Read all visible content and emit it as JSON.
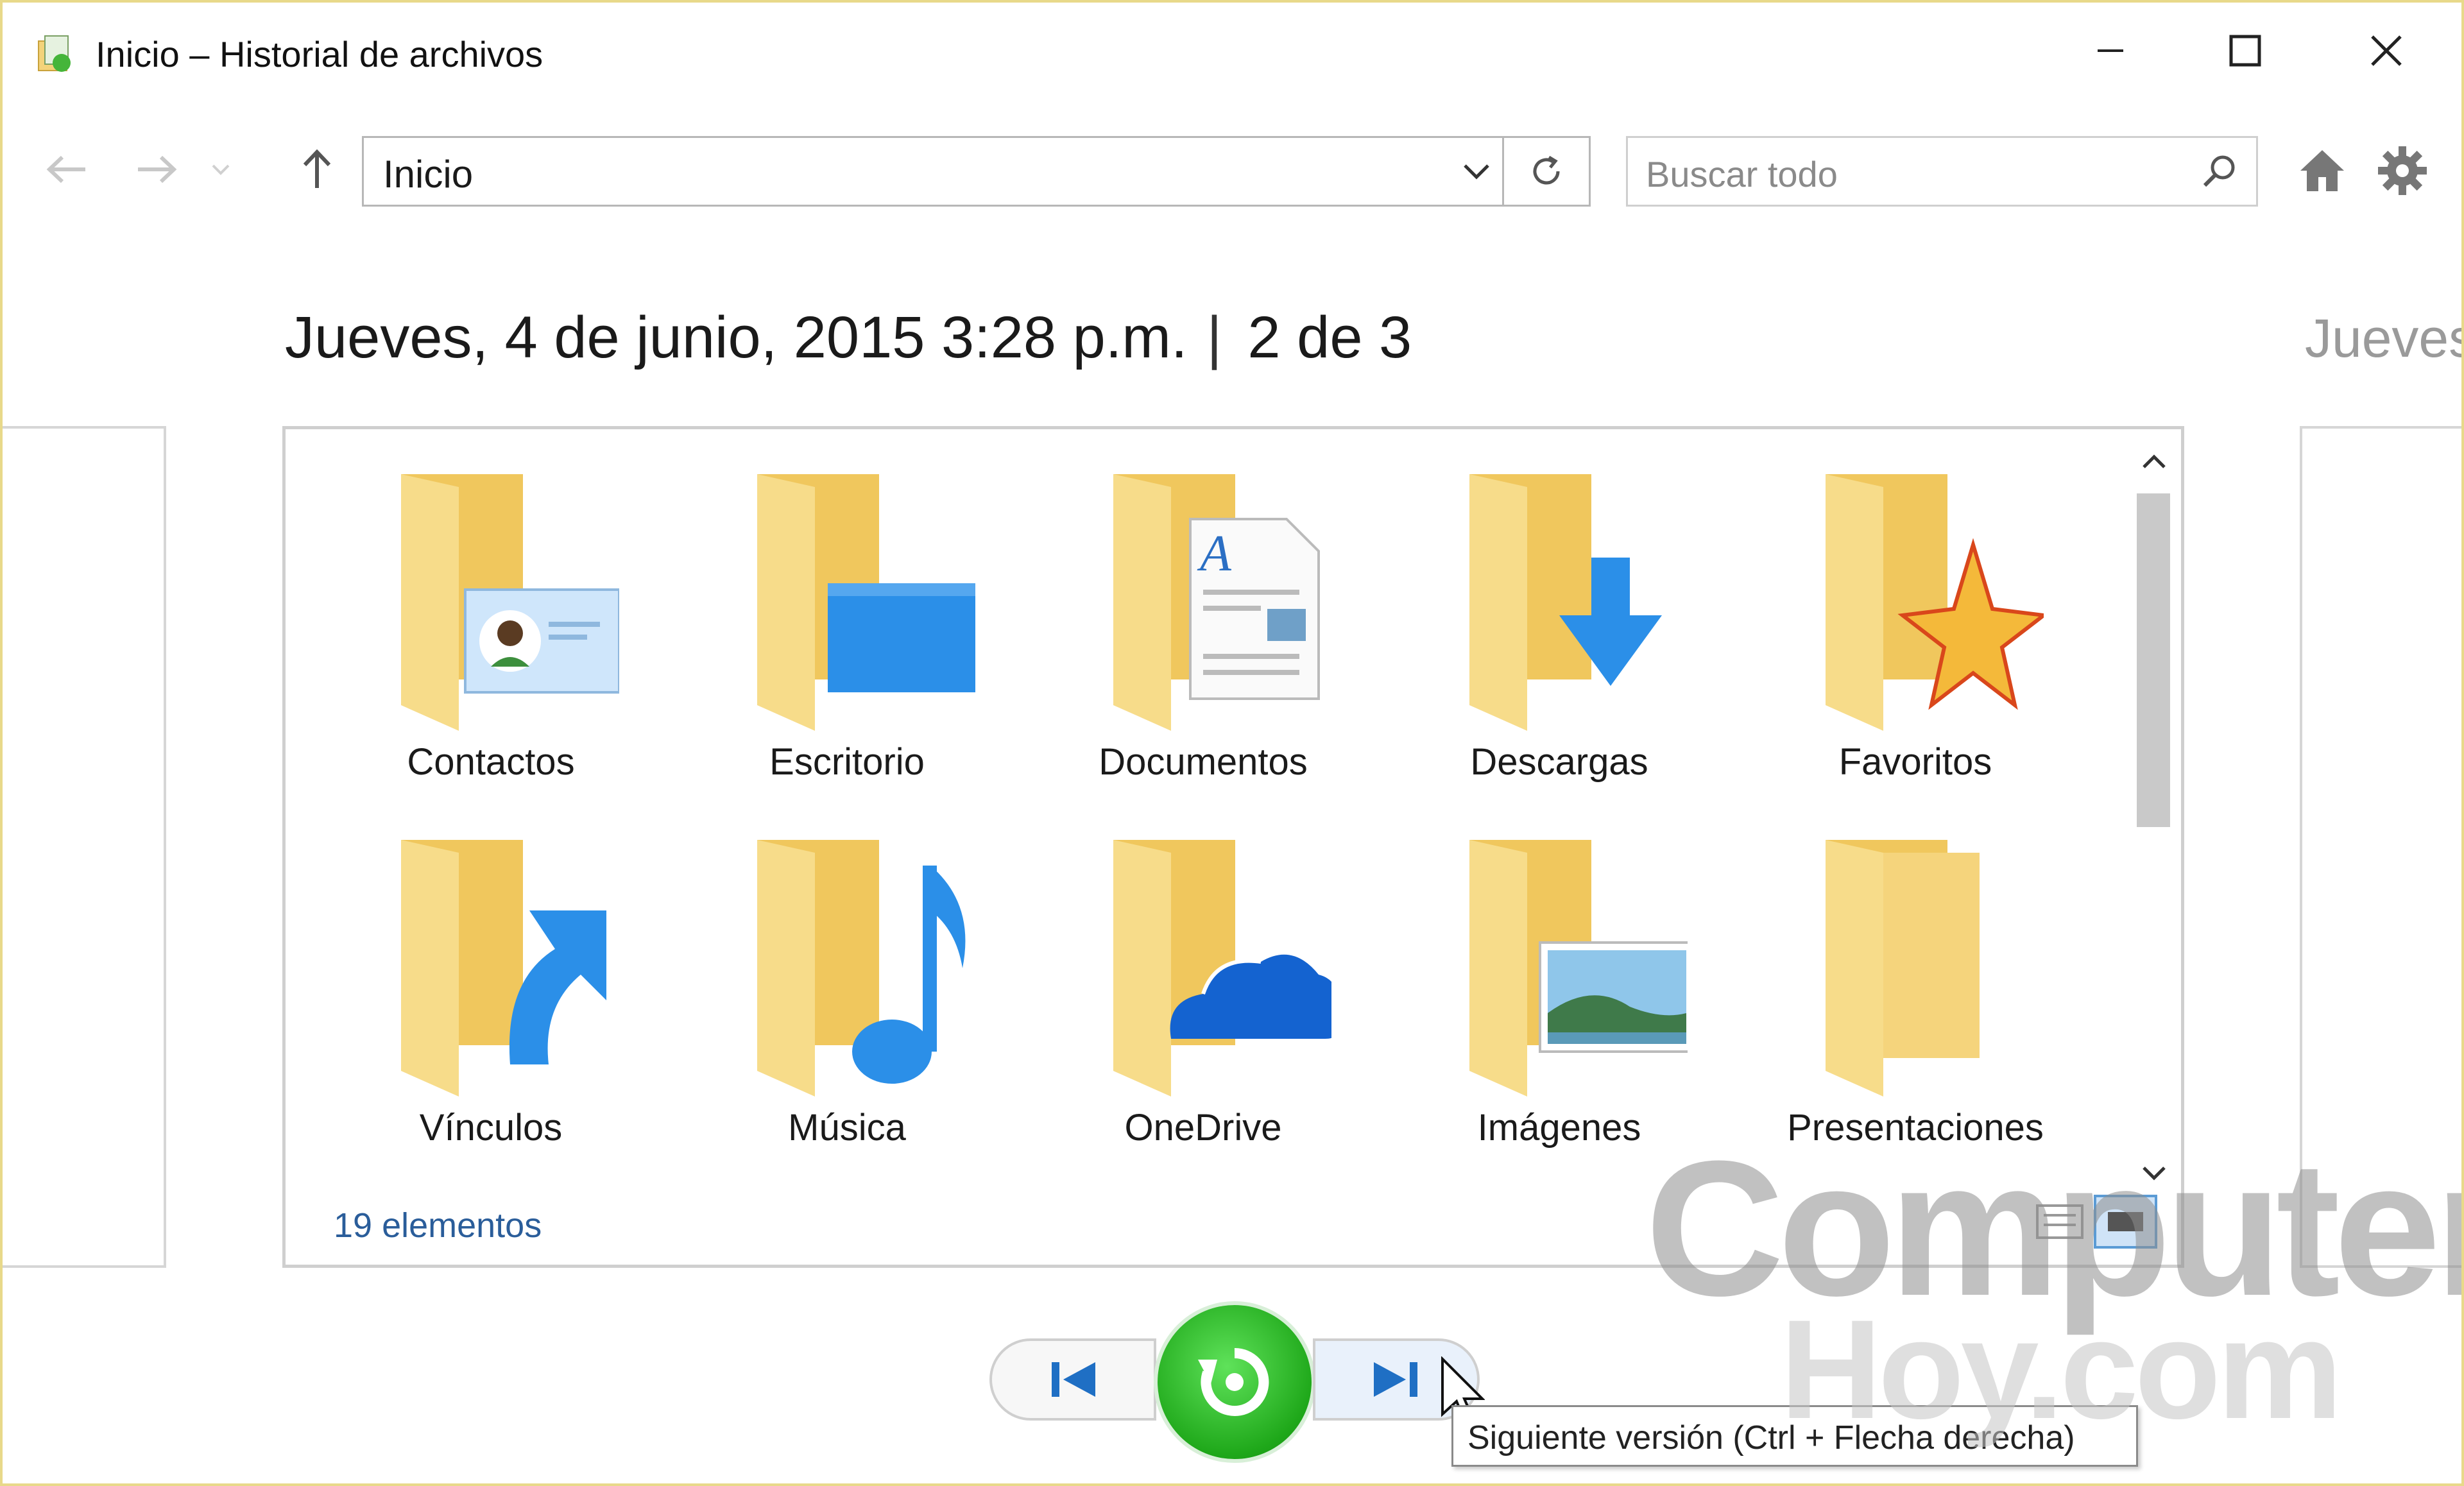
{
  "window": {
    "title": "Inicio – Historial de archivos"
  },
  "toolbar": {
    "address": "Inicio",
    "search_placeholder": "Buscar todo"
  },
  "header": {
    "date": "Jueves, 4 de junio, 2015 3:28 p.m.",
    "separator": "|",
    "version_position": "2 de 3",
    "next_peek": "Jueves"
  },
  "folders": [
    {
      "label": "Contactos",
      "icon": "contacts-folder-icon"
    },
    {
      "label": "Escritorio",
      "icon": "desktop-folder-icon"
    },
    {
      "label": "Documentos",
      "icon": "documents-folder-icon"
    },
    {
      "label": "Descargas",
      "icon": "downloads-folder-icon"
    },
    {
      "label": "Favoritos",
      "icon": "favorites-folder-icon"
    },
    {
      "label": "Vínculos",
      "icon": "links-folder-icon"
    },
    {
      "label": "Música",
      "icon": "music-folder-icon"
    },
    {
      "label": "OneDrive",
      "icon": "onedrive-folder-icon"
    },
    {
      "label": "Imágenes",
      "icon": "pictures-folder-icon"
    },
    {
      "label": "Presentaciones",
      "icon": "presentations-folder-icon"
    }
  ],
  "status": {
    "item_count": "19 elementos"
  },
  "tooltip": {
    "text": "Siguiente versión (Ctrl + Flecha derecha)"
  },
  "watermark": {
    "line1": "Computer",
    "line2": "Hoy.com"
  },
  "colors": {
    "folder": "#f6d36f",
    "accent_blue": "#2b8fe8",
    "restore_green": "#1fa81a",
    "link_blue": "#2a5d9a"
  }
}
